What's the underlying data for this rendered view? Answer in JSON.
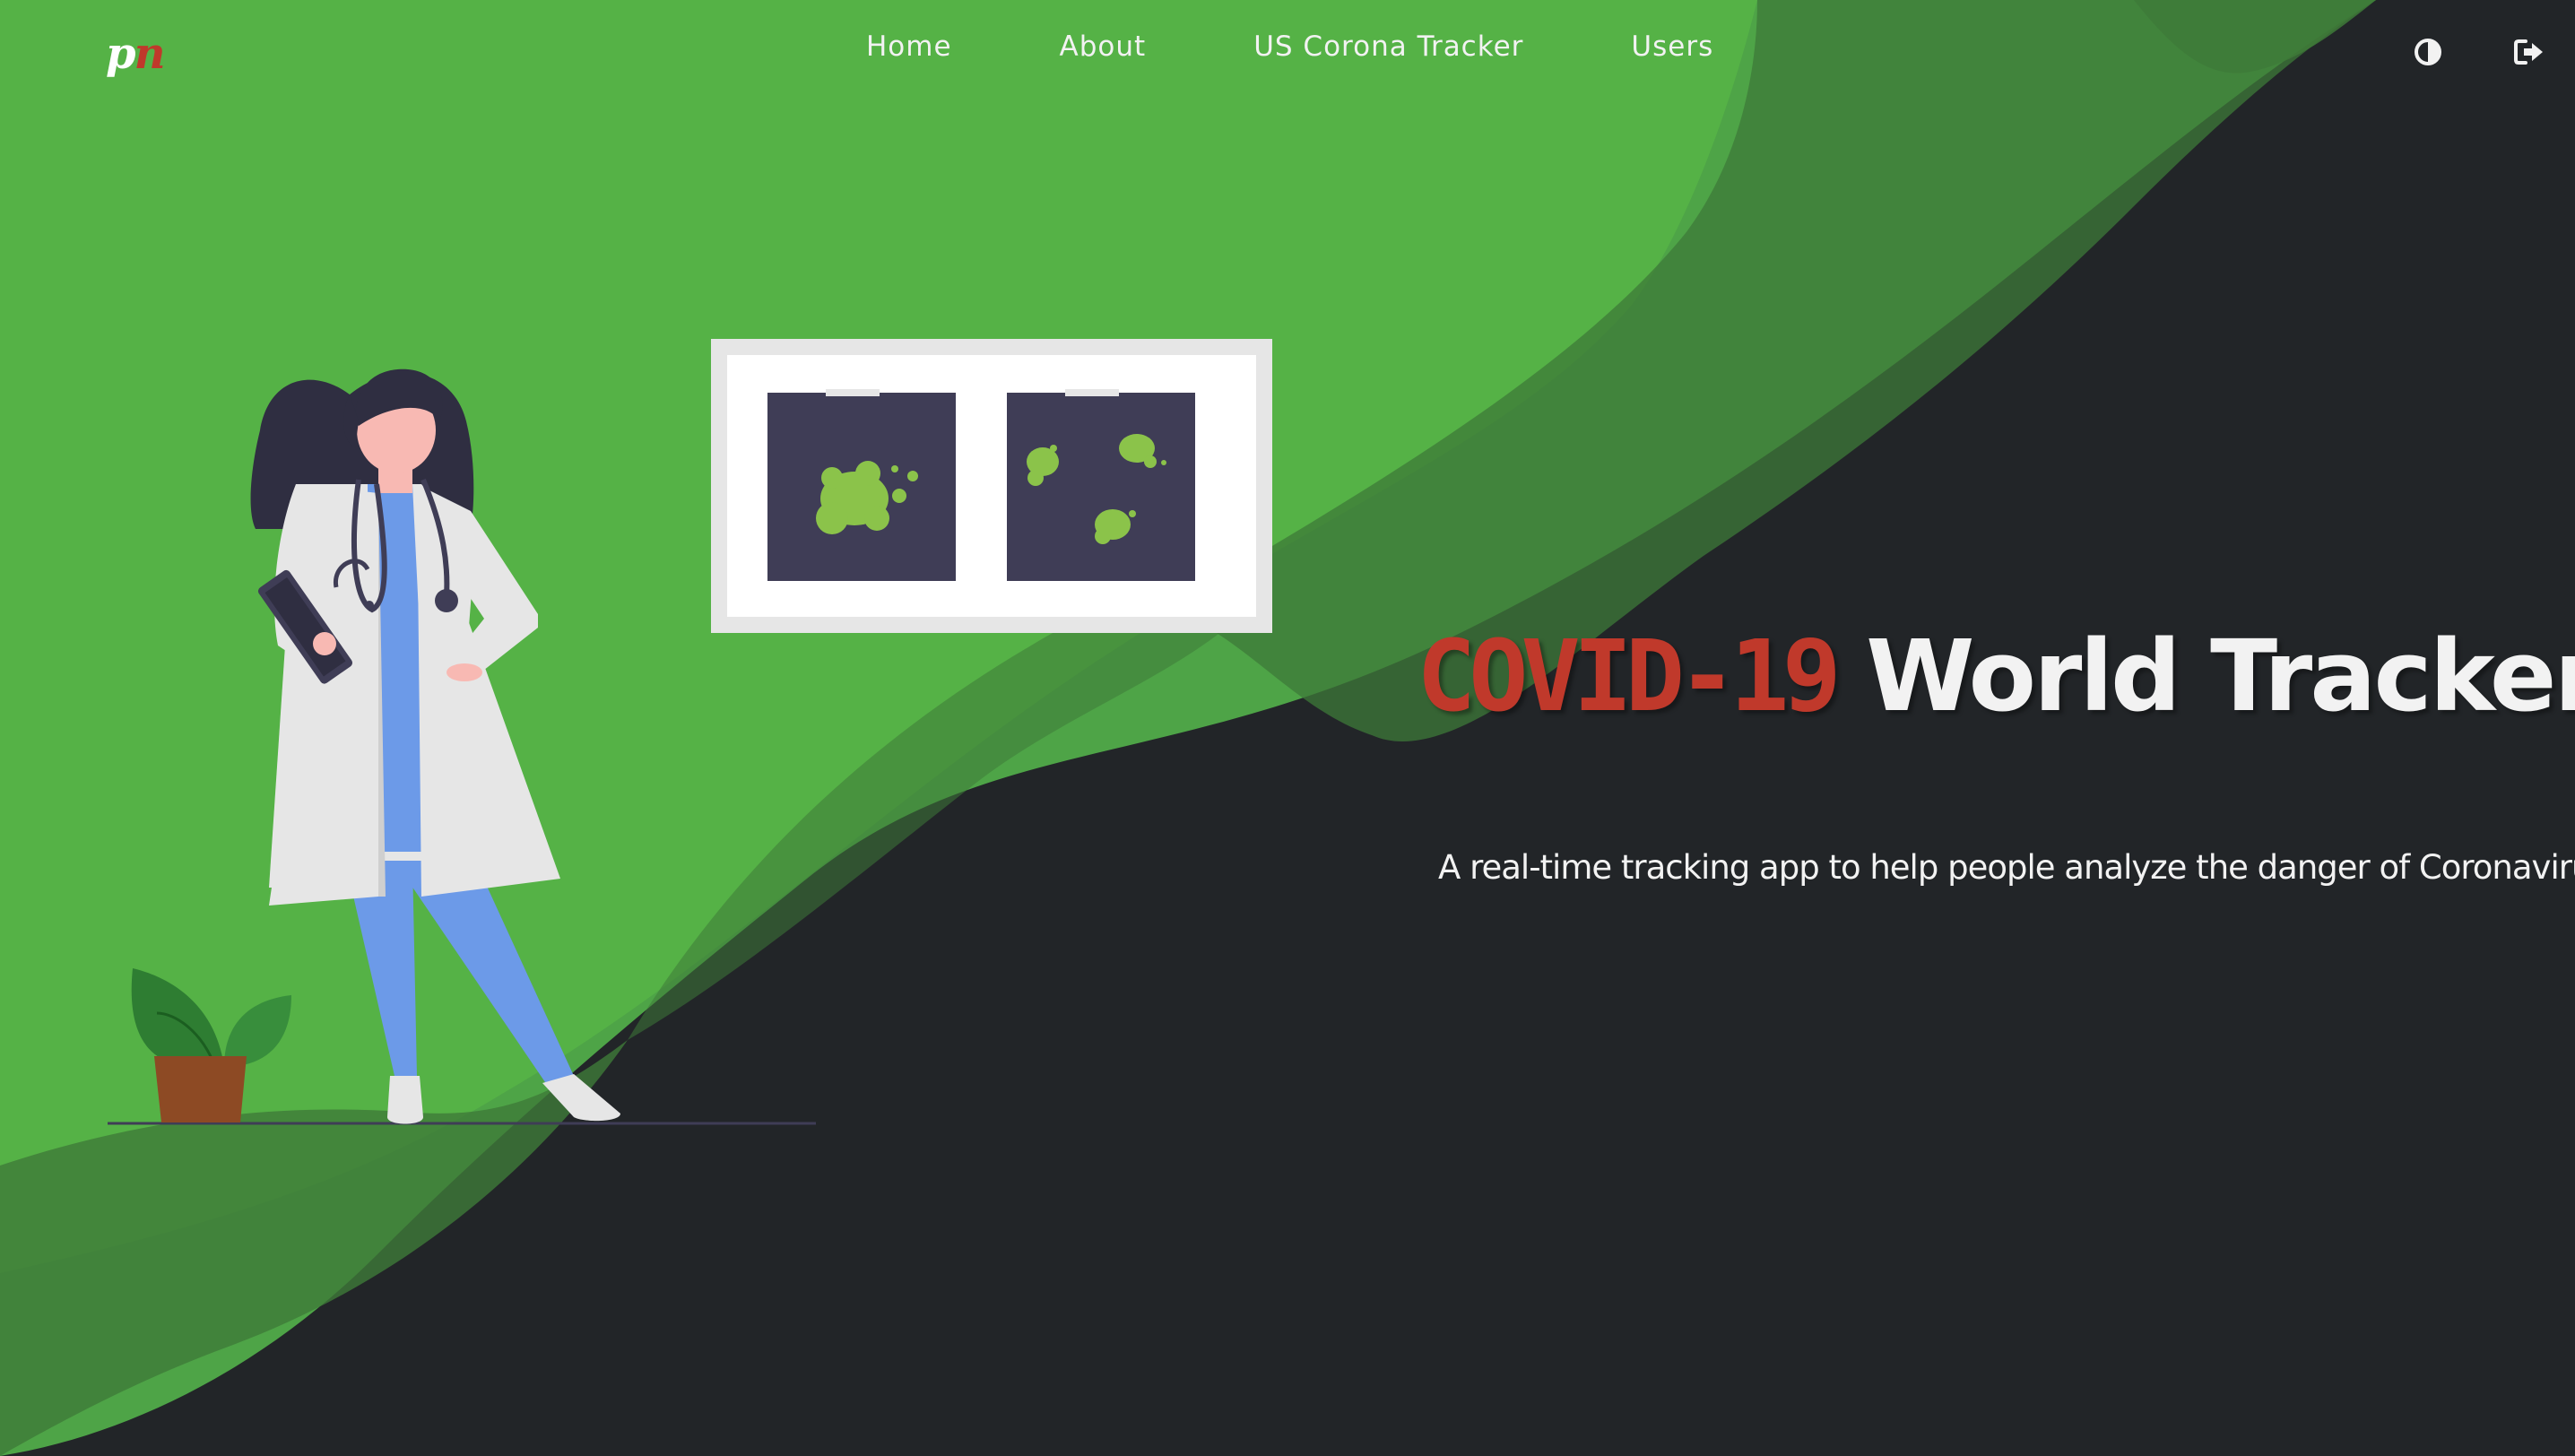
{
  "app": {
    "logo_p": "p",
    "logo_n": "n"
  },
  "nav": {
    "items": [
      {
        "label": "Home"
      },
      {
        "label": "About"
      },
      {
        "label": "US Corona Tracker"
      },
      {
        "label": "Users"
      }
    ]
  },
  "actions": {
    "theme_toggle_icon": "contrast-icon",
    "logout_icon": "sign-out-icon"
  },
  "hero": {
    "title_highlight": "COVID-19",
    "title_rest": "World Tracker",
    "subtitle": "A real-time tracking app to help people analyze the danger of Coronavirus"
  },
  "colors": {
    "green_light": "#57b547",
    "green_mid": "#4ca84a",
    "green_dark": "#3e7a38",
    "background_dark": "#222528",
    "accent_red": "#c0392b",
    "text_light": "#f2f2f2"
  }
}
